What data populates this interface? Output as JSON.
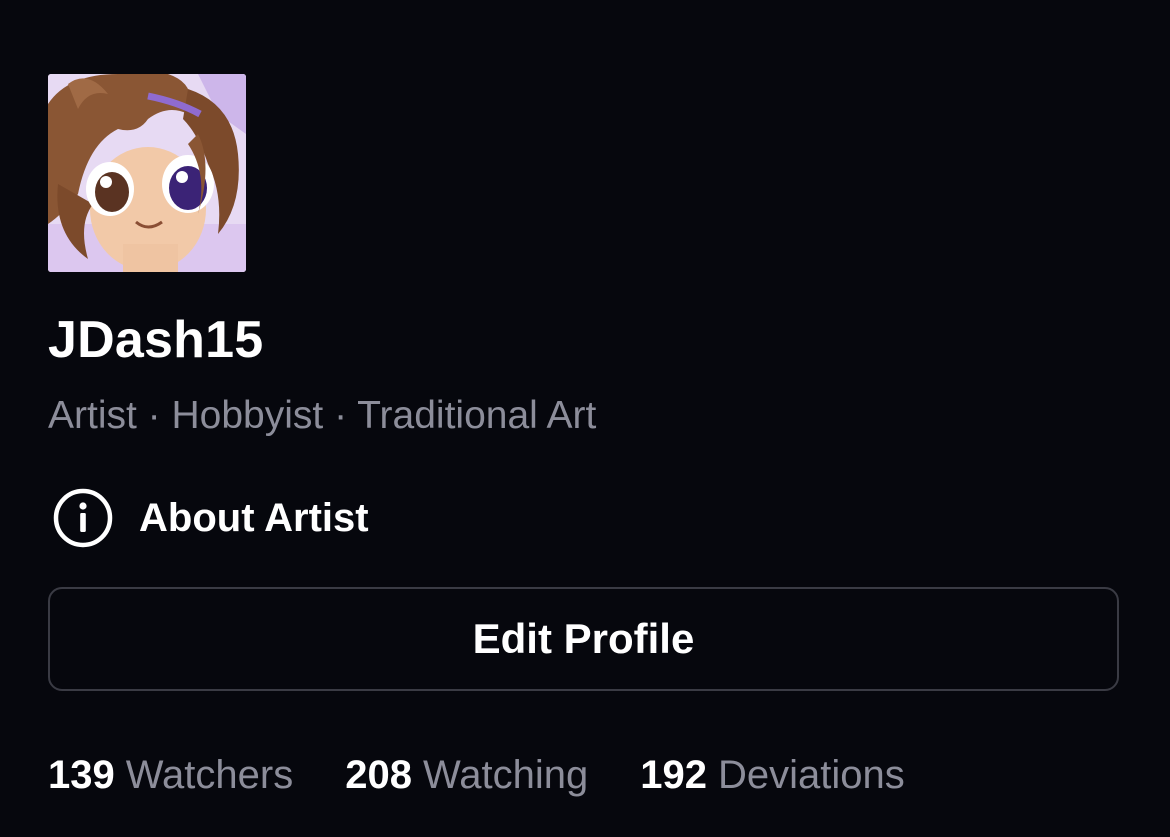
{
  "profile": {
    "username": "JDash15",
    "subtitle": "Artist · Hobbyist · Traditional Art",
    "about_label": "About Artist",
    "edit_label": "Edit Profile"
  },
  "stats": [
    {
      "value": "139",
      "label": "Watchers"
    },
    {
      "value": "208",
      "label": "Watching"
    },
    {
      "value": "192",
      "label": "Deviations"
    }
  ],
  "colors": {
    "background": "#06070d",
    "text_primary": "#ffffff",
    "text_secondary": "#8c8d9a",
    "border": "#3a3b44"
  },
  "icons": {
    "about": "info-icon"
  }
}
